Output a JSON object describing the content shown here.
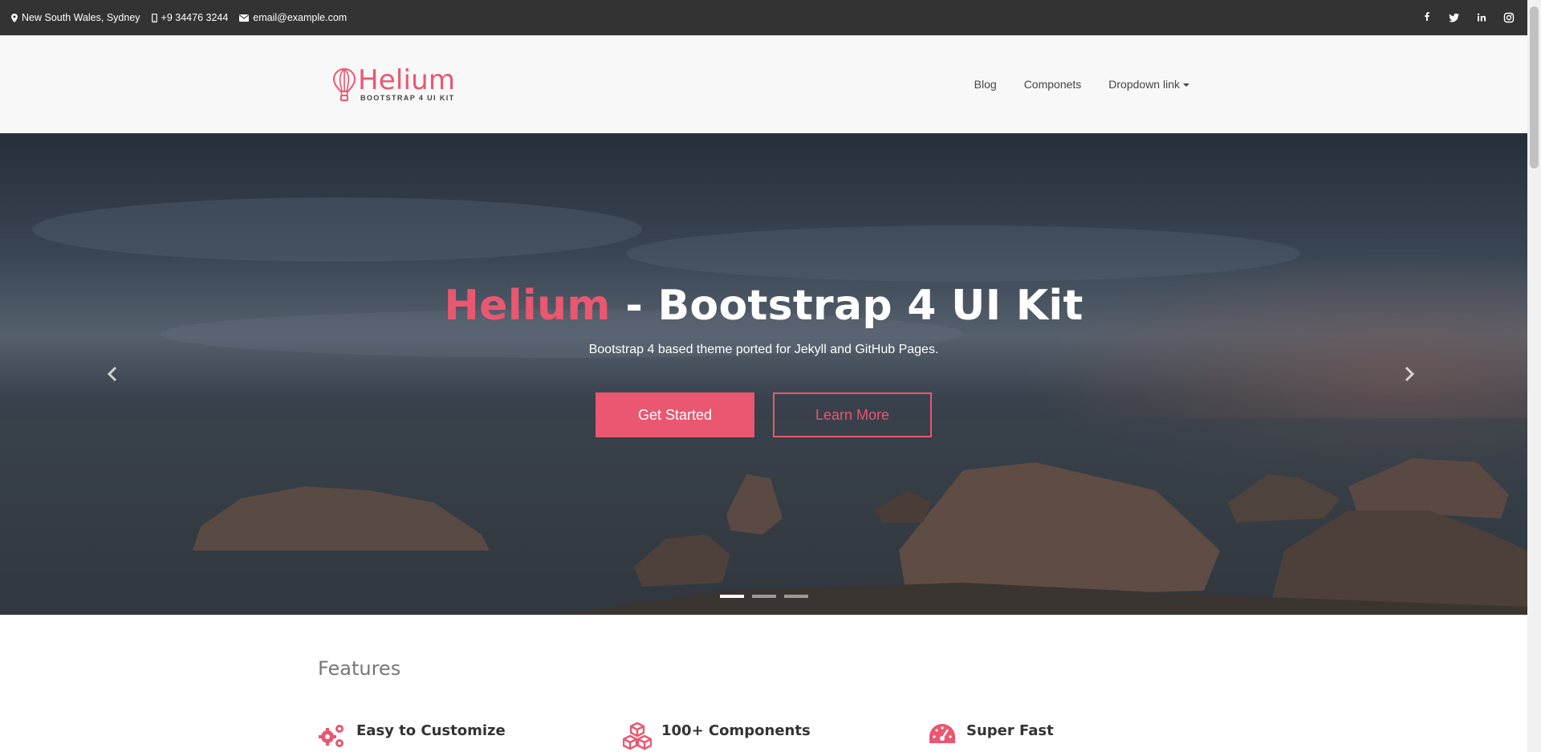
{
  "topbar": {
    "location": "New South Wales, Sydney",
    "phone": "+9 34476 3244",
    "email": "email@example.com",
    "social": [
      "facebook-icon",
      "twitter-icon",
      "linkedin-icon",
      "instagram-icon"
    ]
  },
  "brand": {
    "name": "Helium",
    "tagline": "BOOTSTRAP 4 UI KIT"
  },
  "nav": {
    "items": [
      "Blog",
      "Componets",
      "Dropdown link"
    ]
  },
  "hero": {
    "title_accent": "Helium",
    "title_rest": " - Bootstrap 4 UI Kit",
    "subtitle": "Bootstrap 4 based theme ported for Jekyll and GitHub Pages.",
    "primary_button": "Get Started",
    "secondary_button": "Learn More",
    "slides": 3,
    "active_slide": 1
  },
  "features": {
    "title": "Features",
    "items": [
      {
        "title": "Easy to Customize",
        "icon": "gears-icon"
      },
      {
        "title": "100+ Components",
        "icon": "cubes-icon"
      },
      {
        "title": "Super Fast",
        "icon": "tachometer-icon"
      }
    ]
  },
  "colors": {
    "accent": "#ea5770",
    "topbar": "#333333",
    "navbar": "#f8f8f8"
  }
}
